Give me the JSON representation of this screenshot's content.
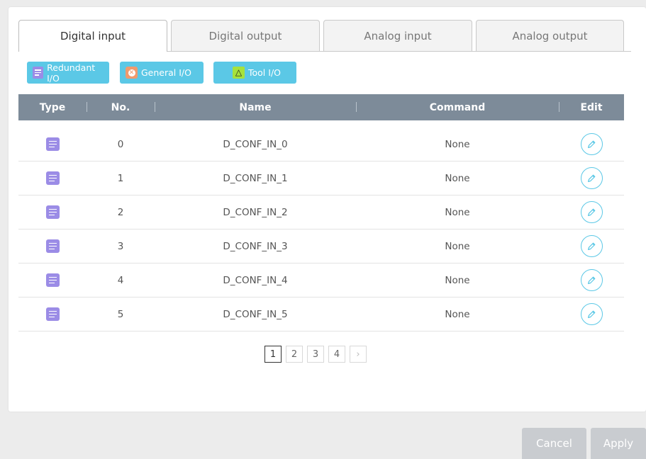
{
  "tabs": [
    {
      "label": "Digital input",
      "active": true
    },
    {
      "label": "Digital output",
      "active": false
    },
    {
      "label": "Analog input",
      "active": false
    },
    {
      "label": "Analog output",
      "active": false
    }
  ],
  "legend": {
    "redundant": "Redundant I/O",
    "general": "General I/O",
    "tool": "Tool I/O"
  },
  "table": {
    "headers": {
      "type": "Type",
      "no": "No.",
      "name": "Name",
      "command": "Command",
      "edit": "Edit"
    },
    "rows": [
      {
        "no": "0",
        "name": "D_CONF_IN_0",
        "command": "None"
      },
      {
        "no": "1",
        "name": "D_CONF_IN_1",
        "command": "None"
      },
      {
        "no": "2",
        "name": "D_CONF_IN_2",
        "command": "None"
      },
      {
        "no": "3",
        "name": "D_CONF_IN_3",
        "command": "None"
      },
      {
        "no": "4",
        "name": "D_CONF_IN_4",
        "command": "None"
      },
      {
        "no": "5",
        "name": "D_CONF_IN_5",
        "command": "None"
      }
    ]
  },
  "pagination": {
    "pages": [
      "1",
      "2",
      "3",
      "4"
    ],
    "current": "1",
    "next": "›"
  },
  "footer": {
    "cancel": "Cancel",
    "apply": "Apply"
  },
  "colors": {
    "accent": "#5bc8e6",
    "header": "#7d8b99",
    "redundant": "#9b8ce6",
    "general": "#f09a6e",
    "tool": "#a6e23c"
  }
}
